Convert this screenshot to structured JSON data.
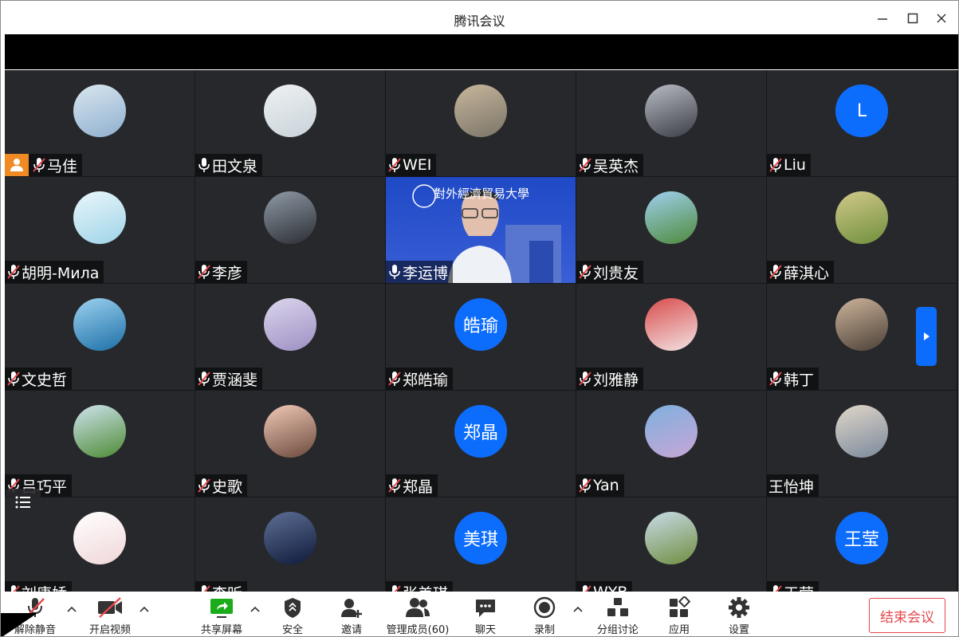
{
  "window": {
    "title": "腾讯会议"
  },
  "participants": [
    {
      "name": "马佳",
      "mic": "muted",
      "host": true,
      "avatar_text": "",
      "avatar_color": "#8fb0cf",
      "avatar_color2": "#d9e6ef"
    },
    {
      "name": "田文泉",
      "mic": "on",
      "avatar_text": "",
      "avatar_color": "#c9d3da",
      "avatar_color2": "#eef1f3"
    },
    {
      "name": "WEI",
      "mic": "muted",
      "avatar_text": "",
      "avatar_color": "#7a7468",
      "avatar_color2": "#c8b79c"
    },
    {
      "name": "吴英杰",
      "mic": "muted",
      "avatar_text": "",
      "avatar_color": "#3b3d45",
      "avatar_color2": "#b8bcc4"
    },
    {
      "name": "Liu",
      "mic": "muted",
      "avatar_text": "L",
      "avatar_color": "#0c6dfd"
    },
    {
      "name": "胡明-Мила",
      "mic": "muted",
      "avatar_text": "",
      "avatar_color": "#9fd4e8",
      "avatar_color2": "#e9f6fb"
    },
    {
      "name": "李彦",
      "mic": "muted",
      "avatar_text": "",
      "avatar_color": "#2b2e33",
      "avatar_color2": "#8f9aa6"
    },
    {
      "name": "李运博",
      "mic": "on",
      "video": true,
      "video_banner": "對外經濟貿易大學"
    },
    {
      "name": "刘贵友",
      "mic": "muted",
      "avatar_text": "",
      "avatar_color": "#4e8a3a",
      "avatar_color2": "#9fd0ef"
    },
    {
      "name": "薛淇心",
      "mic": "muted",
      "avatar_text": "",
      "avatar_color": "#6f8f3c",
      "avatar_color2": "#d2c98a"
    },
    {
      "name": "文史哲",
      "mic": "muted",
      "avatar_text": "",
      "avatar_color": "#1d6fa8",
      "avatar_color2": "#9cd2ef"
    },
    {
      "name": "贾涵斐",
      "mic": "muted",
      "avatar_text": "",
      "avatar_color": "#9d8fc4",
      "avatar_color2": "#dcd6ec"
    },
    {
      "name": "郑皓瑜",
      "mic": "muted",
      "avatar_text": "皓瑜",
      "avatar_color": "#0c6dfd"
    },
    {
      "name": "刘雅静",
      "mic": "muted",
      "avatar_text": "",
      "avatar_color": "#f3e3e3",
      "avatar_color2": "#d94c4c"
    },
    {
      "name": "韩丁",
      "mic": "muted",
      "avatar_text": "",
      "avatar_color": "#4b4038",
      "avatar_color2": "#cdb49a"
    },
    {
      "name": "吕巧平",
      "mic": "muted",
      "avatar_text": "",
      "avatar_color": "#4d8b33",
      "avatar_color2": "#cfe3ef"
    },
    {
      "name": "史歌",
      "mic": "muted",
      "avatar_text": "",
      "avatar_color": "#6b4a3c",
      "avatar_color2": "#f1c9b7"
    },
    {
      "name": "郑晶",
      "mic": "muted",
      "avatar_text": "郑晶",
      "avatar_color": "#0c6dfd"
    },
    {
      "name": "Yan",
      "mic": "muted",
      "avatar_text": "",
      "avatar_color": "#c7a6d6",
      "avatar_color2": "#7fb0de"
    },
    {
      "name": "王怡坤",
      "mic": "none",
      "avatar_text": "",
      "avatar_color": "#7a8a9c",
      "avatar_color2": "#e1d6c9"
    },
    {
      "name": "刘唐娇",
      "mic": "muted",
      "avatar_text": "",
      "avatar_color": "#f0d6d8",
      "avatar_color2": "#ffffff"
    },
    {
      "name": "李昕",
      "mic": "muted",
      "avatar_text": "",
      "avatar_color": "#0f1a3a",
      "avatar_color2": "#5e6f95"
    },
    {
      "name": "张美琪",
      "mic": "muted",
      "avatar_text": "美琪",
      "avatar_color": "#0c6dfd"
    },
    {
      "name": "WYB",
      "mic": "muted",
      "avatar_text": "",
      "avatar_color": "#6f8e3f",
      "avatar_color2": "#c9dbe9"
    },
    {
      "name": "王莹",
      "mic": "muted",
      "avatar_text": "王莹",
      "avatar_color": "#0c6dfd"
    }
  ],
  "toolbar": {
    "unmute": "解除静音",
    "start_video": "开启视频",
    "share_screen": "共享屏幕",
    "security": "安全",
    "invite": "邀请",
    "manage_members": "管理成员(60)",
    "chat": "聊天",
    "record": "录制",
    "breakout": "分组讨论",
    "apps": "应用",
    "settings": "设置",
    "end_meeting": "结束会议"
  },
  "colors": {
    "accent": "#0c6dfd",
    "end_red": "#e5484d",
    "host_orange": "#f08a24",
    "share_green": "#1aad19"
  }
}
